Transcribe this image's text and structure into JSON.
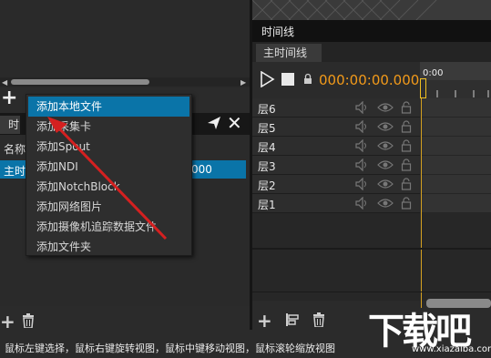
{
  "left_panel": {
    "tab_stub": "时",
    "list_header": "名称",
    "list_row_label": "主时",
    "list_row_value": "000"
  },
  "context_menu": {
    "items": [
      {
        "label": "添加本地文件",
        "highlighted": true
      },
      {
        "label": "添加采集卡",
        "highlighted": false
      },
      {
        "label": "添加Spout",
        "highlighted": false
      },
      {
        "label": "添加NDI",
        "highlighted": false
      },
      {
        "label": "添加NotchBlock",
        "highlighted": false
      },
      {
        "label": "添加网络图片",
        "highlighted": false
      },
      {
        "label": "添加摄像机追踪数据文件",
        "highlighted": false
      },
      {
        "label": "添加文件夹",
        "highlighted": false
      }
    ]
  },
  "timeline": {
    "title": "时间线",
    "tab": "主时间线",
    "timecode": "000:00:00.000",
    "ruler_label": "0:00",
    "layers": [
      "层6",
      "层5",
      "层4",
      "层3",
      "层2",
      "层1"
    ]
  },
  "status_bar": {
    "text": "鼠标左键选择，鼠标右键旋转视图，鼠标中键移动视图，鼠标滚轮缩放视图"
  },
  "watermark": {
    "brand": "下载吧",
    "url": "www.xiazaiba.com"
  },
  "colors": {
    "accent_blue": "#0a74a8",
    "timecode_orange": "#f29a1a",
    "arrow_red": "#d42020"
  }
}
